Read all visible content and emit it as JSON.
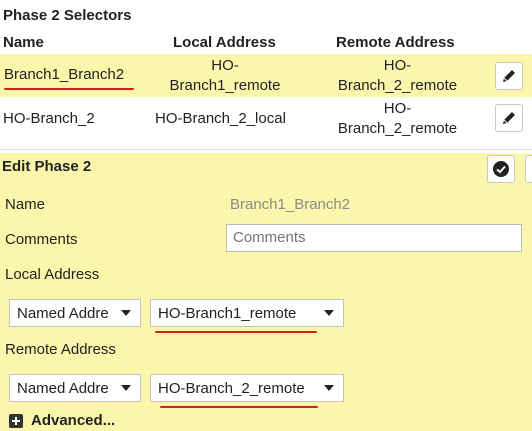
{
  "section_title": "Phase 2 Selectors",
  "columns": {
    "name": "Name",
    "local": "Local Address",
    "remote": "Remote Address"
  },
  "rows": [
    {
      "name": "Branch1_Branch2",
      "local_l1": "HO-",
      "local_l2": "Branch1_remote",
      "remote_l1": "HO-",
      "remote_l2": "Branch_2_remote"
    },
    {
      "name": "HO-Branch_2",
      "local": "HO-Branch_2_local",
      "remote_l1": "HO-",
      "remote_l2": "Branch_2_remote"
    }
  ],
  "edit": {
    "title": "Edit Phase 2",
    "name_label": "Name",
    "name_value": "Branch1_Branch2",
    "comments_label": "Comments",
    "comments_placeholder": "Comments",
    "local_label": "Local Address",
    "local_type": "Named Addre",
    "local_value": "HO-Branch1_remote",
    "remote_label": "Remote Address",
    "remote_type": "Named Addre",
    "remote_value": "HO-Branch_2_remote",
    "advanced_label": "Advanced..."
  },
  "colors": {
    "selected_row": "#fbf6ab",
    "annotation_red": "#d0231c"
  },
  "icons": {
    "edit": "pencil-icon",
    "confirm": "checkmark-icon",
    "advanced": "plus-square-icon"
  }
}
